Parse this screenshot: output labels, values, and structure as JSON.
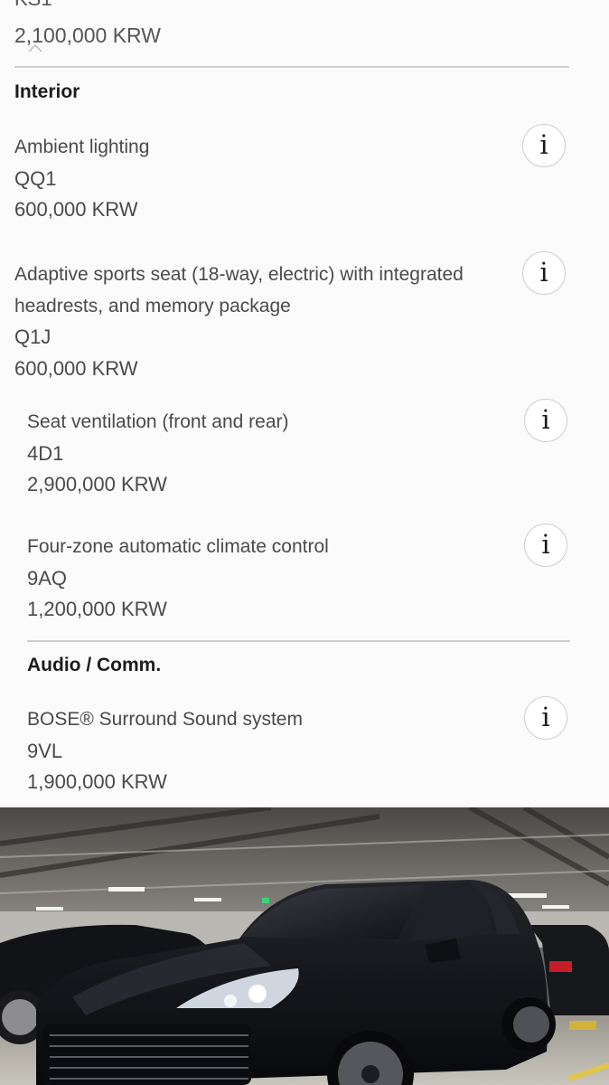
{
  "partial_top": {
    "code": "KS1",
    "price": "2,100,000 KRW"
  },
  "sections": [
    {
      "heading": "Interior",
      "options": [
        {
          "title_lines": [
            "Ambient lighting"
          ],
          "code": "QQ1",
          "price": "600,000 KRW"
        },
        {
          "title_lines": [
            "Adaptive sports seat (18-way, electric) with integrated",
            "headrests, and memory package"
          ],
          "code": "Q1J",
          "price": "600,000 KRW"
        },
        {
          "title_lines": [
            "Seat ventilation (front and rear)"
          ],
          "code": "4D1",
          "price": "2,900,000 KRW"
        },
        {
          "title_lines": [
            "Four-zone automatic climate control"
          ],
          "code": "9AQ",
          "price": "1,200,000 KRW"
        }
      ]
    },
    {
      "heading": "Audio / Comm.",
      "options": [
        {
          "title_lines": [
            "BOSE® Surround Sound system"
          ],
          "code": "9VL",
          "price": "1,900,000 KRW"
        }
      ]
    }
  ],
  "info_button_glyph": "i",
  "icons": {
    "info": "info-icon",
    "scroll": "chevron-up-icon"
  },
  "photo": {
    "description_free": true
  },
  "colors": {
    "background": "#fbfbfb",
    "text": "#4a4a4a",
    "heading": "#1c1c1c",
    "divider": "#cfcfcf",
    "car_body": "#0d0e12"
  }
}
